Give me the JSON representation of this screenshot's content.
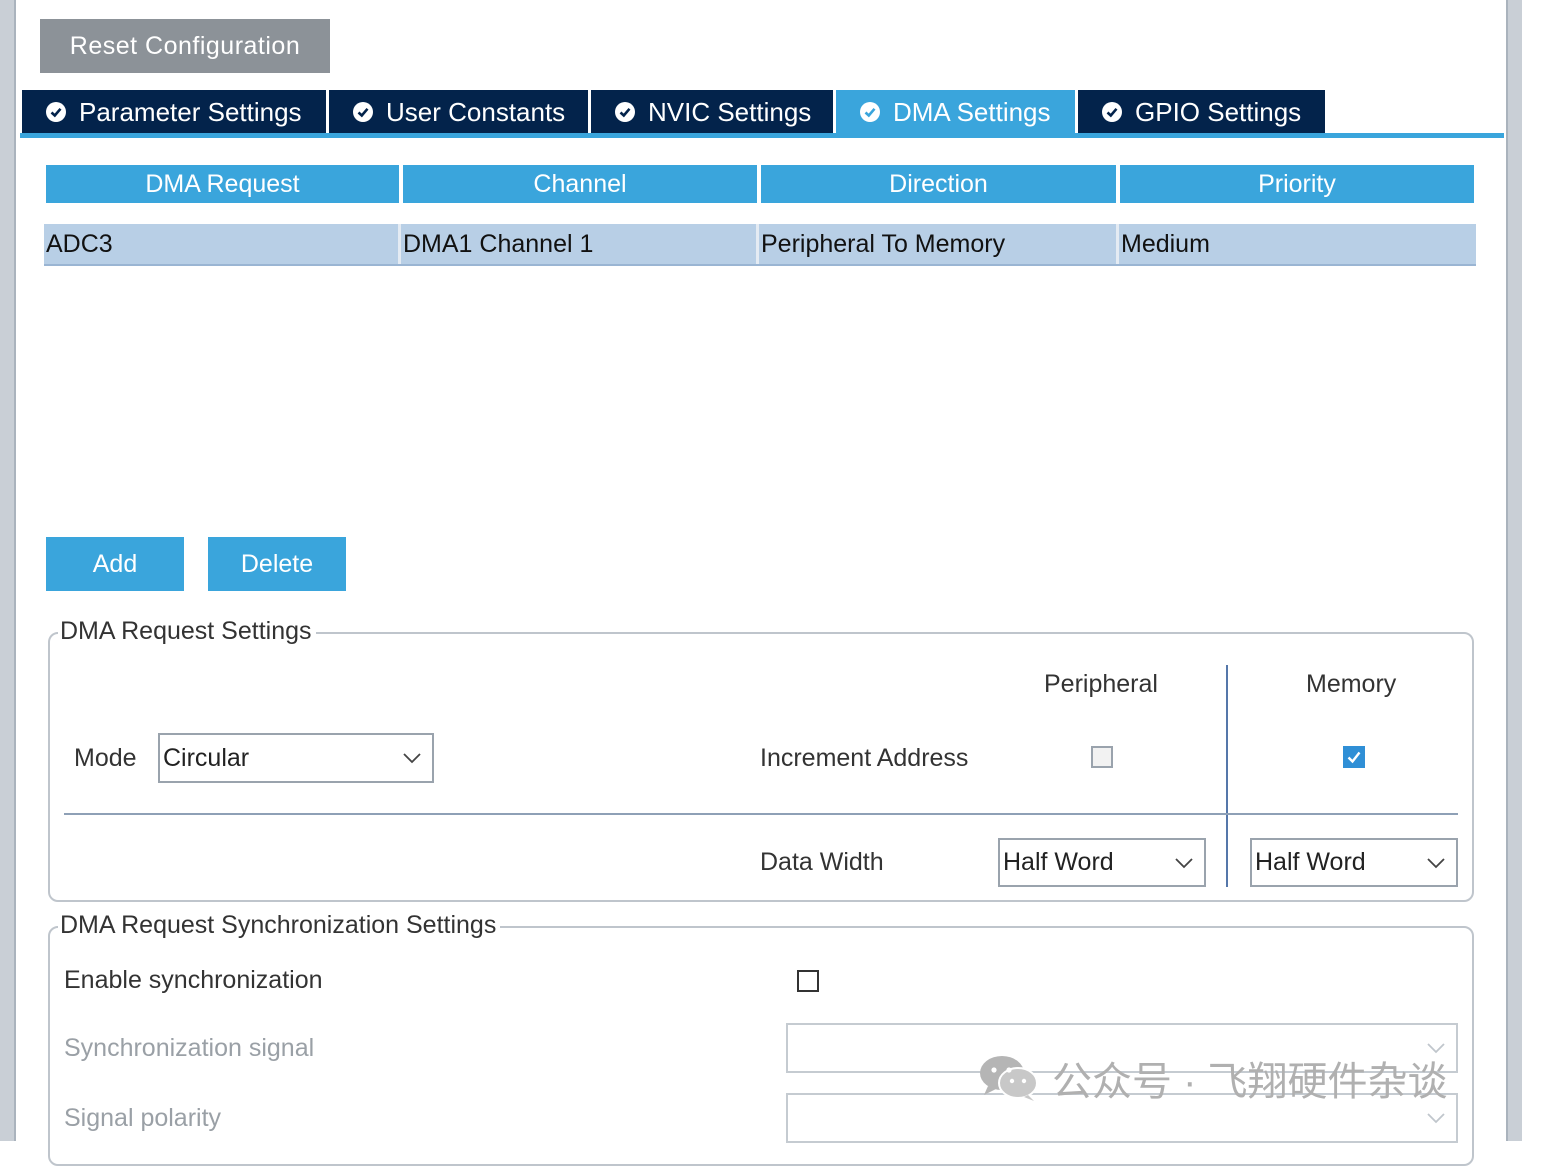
{
  "toolbar": {
    "reset_label": "Reset Configuration"
  },
  "tabs": [
    {
      "label": "Parameter Settings",
      "active": false
    },
    {
      "label": "User Constants",
      "active": false
    },
    {
      "label": "NVIC Settings",
      "active": false
    },
    {
      "label": "DMA Settings",
      "active": true
    },
    {
      "label": "GPIO Settings",
      "active": false
    }
  ],
  "dma_table": {
    "headers": [
      "DMA Request",
      "Channel",
      "Direction",
      "Priority"
    ],
    "rows": [
      [
        "ADC3",
        "DMA1 Channel 1",
        "Peripheral To Memory",
        "Medium"
      ]
    ]
  },
  "actions": {
    "add_label": "Add",
    "delete_label": "Delete"
  },
  "request_settings": {
    "legend": "DMA Request Settings",
    "peripheral_header": "Peripheral",
    "memory_header": "Memory",
    "mode_label": "Mode",
    "mode_value": "Circular",
    "increment_label": "Increment Address",
    "peripheral_increment": false,
    "memory_increment": true,
    "data_width_label": "Data Width",
    "peripheral_width": "Half Word",
    "memory_width": "Half Word"
  },
  "sync_settings": {
    "legend": "DMA Request Synchronization Settings",
    "enable_label": "Enable synchronization",
    "enable_checked": false,
    "signal_label": "Synchronization signal",
    "signal_value": "",
    "polarity_label": "Signal polarity",
    "polarity_value": ""
  },
  "watermark": {
    "text": "公众号 · 飞翔硬件杂谈"
  },
  "colors": {
    "accent": "#3aa5dc",
    "tab_dark": "#03234b",
    "row_selected": "#b8cfe6",
    "reset_button": "#8c9298"
  }
}
